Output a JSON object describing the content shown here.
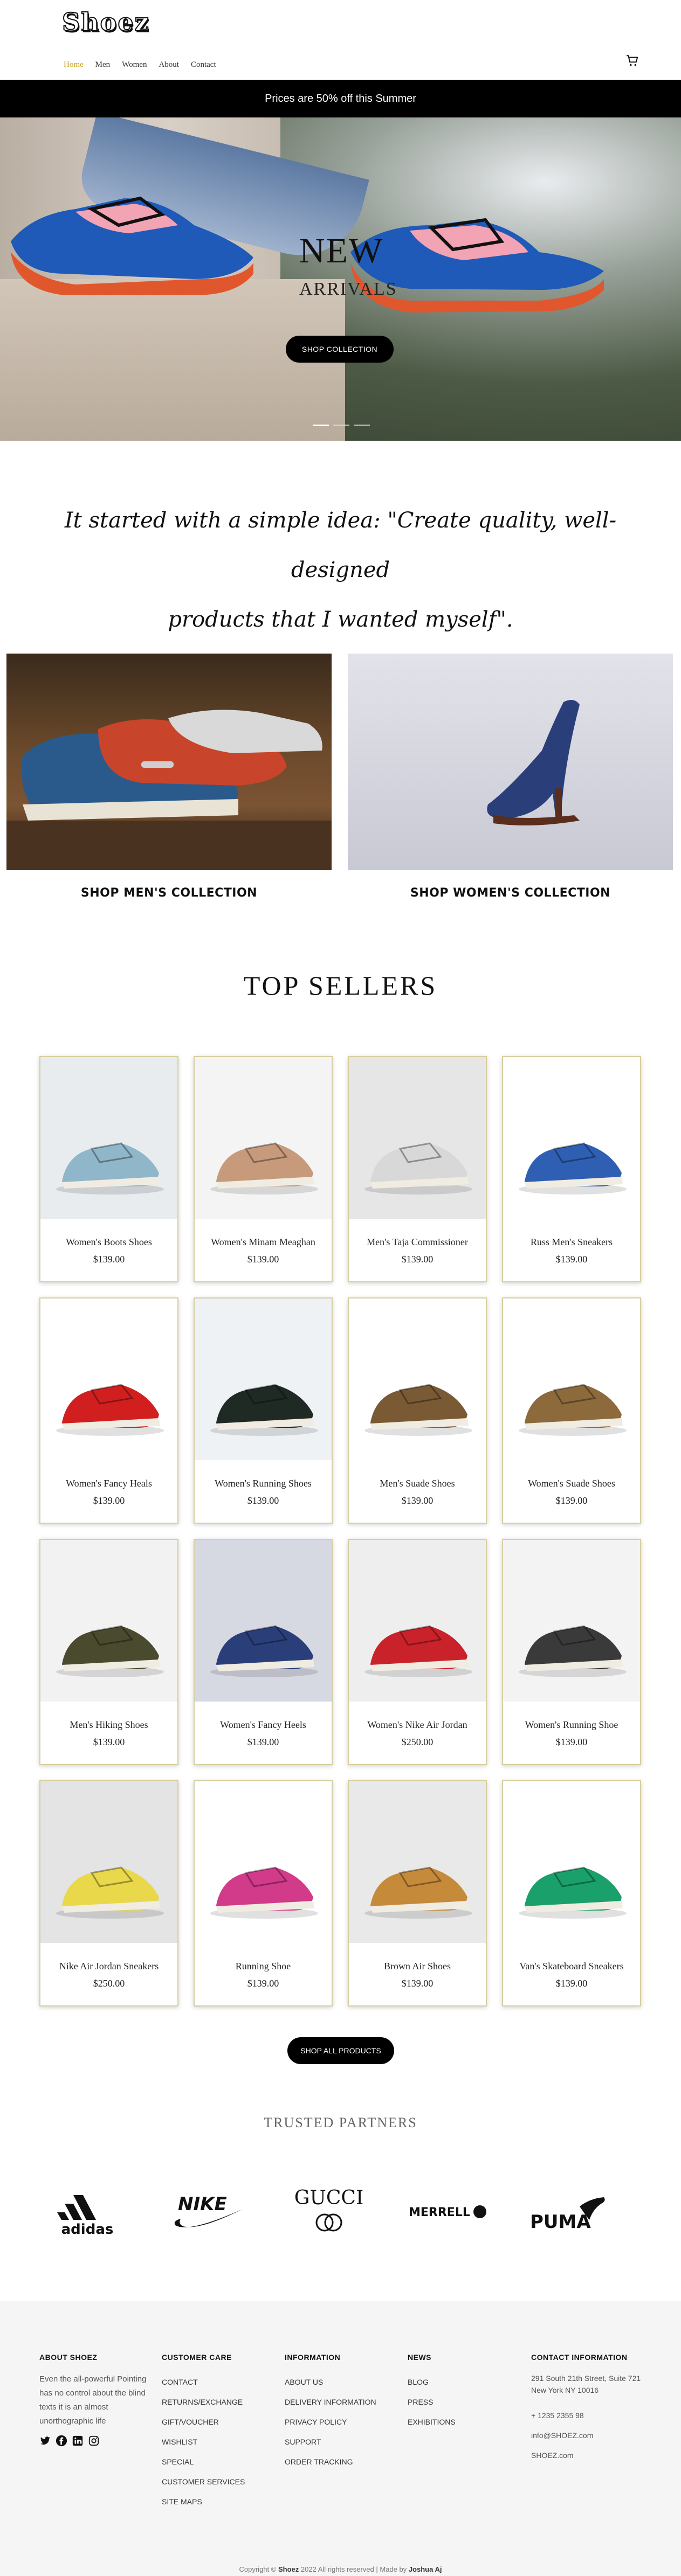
{
  "header": {
    "logo": "Shoez",
    "nav": [
      "Home",
      "Men",
      "Women",
      "About",
      "Contact"
    ],
    "promo": "Prices are 50% off this Summer"
  },
  "hero": {
    "title": "NEW",
    "subtitle": "ARRIVALS",
    "button": "SHOP COLLECTION"
  },
  "quote": {
    "line1": "It started with a simple idea: \"Create quality, well-designed",
    "line2": "products that I wanted myself\"."
  },
  "collections": {
    "men": "SHOP MEN'S COLLECTION",
    "women": "SHOP WOMEN'S COLLECTION"
  },
  "top_sellers": {
    "title": "TOP SELLERS",
    "products": [
      {
        "name": "Women's Boots Shoes",
        "price": "$139.00"
      },
      {
        "name": "Women's Minam Meaghan",
        "price": "$139.00"
      },
      {
        "name": "Men's Taja Commissioner",
        "price": "$139.00"
      },
      {
        "name": "Russ Men's Sneakers",
        "price": "$139.00"
      },
      {
        "name": "Women's Fancy Heals",
        "price": "$139.00"
      },
      {
        "name": "Women's Running Shoes",
        "price": "$139.00"
      },
      {
        "name": "Men's Suade Shoes",
        "price": "$139.00"
      },
      {
        "name": "Women's Suade Shoes",
        "price": "$139.00"
      },
      {
        "name": "Men's Hiking Shoes",
        "price": "$139.00"
      },
      {
        "name": "Women's Fancy Heels",
        "price": "$139.00"
      },
      {
        "name": "Women's Nike Air Jordan",
        "price": "$250.00"
      },
      {
        "name": "Women's Running Shoe",
        "price": "$139.00"
      },
      {
        "name": "Nike Air Jordan Sneakers",
        "price": "$250.00"
      },
      {
        "name": "Running Shoe",
        "price": "$139.00"
      },
      {
        "name": "Brown Air Shoes",
        "price": "$139.00"
      },
      {
        "name": "Van's Skateboard Sneakers",
        "price": "$139.00"
      }
    ],
    "all_button": "SHOP ALL PRODUCTS"
  },
  "partners": {
    "title": "TRUSTED PARTNERS",
    "brands": [
      "adidas",
      "NIKE",
      "GUCCI",
      "MERRELL",
      "PUMA"
    ]
  },
  "footer": {
    "about_title": "ABOUT SHOEZ",
    "about_text": "Even the all-powerful Pointing has no control about the blind texts it is an almost unorthographic life",
    "care_title": "CUSTOMER CARE",
    "care_links": [
      "CONTACT",
      "RETURNS/EXCHANGE",
      "GIFT/VOUCHER",
      "WISHLIST",
      "SPECIAL",
      "CUSTOMER SERVICES",
      "SITE MAPS"
    ],
    "info_title": "INFORMATION",
    "info_links": [
      "ABOUT US",
      "DELIVERY INFORMATION",
      "PRIVACY POLICY",
      "SUPPORT",
      "ORDER TRACKING"
    ],
    "news_title": "NEWS",
    "news_links": [
      "BLOG",
      "PRESS",
      "EXHIBITIONS"
    ],
    "contact_title": "CONTACT INFORMATION",
    "contact_address1": "291 South 21th Street, Suite 721",
    "contact_address2": "New York NY 10016",
    "contact_phone": "+ 1235 2355 98",
    "contact_email": "info@SHOEZ.com",
    "contact_site": "SHOEZ.com",
    "copyright_pre": "Copyright ©",
    "copyright_brand": "Shoez",
    "copyright_mid": "2022 All rights reserved | Made by",
    "copyright_author": "Joshua Aj"
  }
}
